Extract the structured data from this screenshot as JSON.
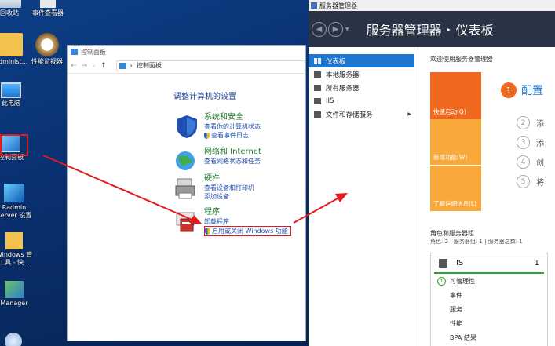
{
  "desktop": {
    "icons": [
      {
        "label": "回收站"
      },
      {
        "label": "事件查看器"
      },
      {
        "label": "Administ..."
      },
      {
        "label": "性能监视器"
      },
      {
        "label": "此电脑"
      },
      {
        "label": "控制面板"
      },
      {
        "label": "Radmin"
      },
      {
        "label": "Server 设置"
      },
      {
        "label": "Windows 管"
      },
      {
        "label": "工具 - 快..."
      },
      {
        "label": "Manager"
      }
    ]
  },
  "control_panel": {
    "window_title": "控制面板",
    "address": "控制面板",
    "heading": "调整计算机的设置",
    "categories": [
      {
        "title": "系统和安全",
        "links": [
          "查看你的计算机状态",
          "查看事件日志"
        ]
      },
      {
        "title": "网络和 Internet",
        "links": [
          "查看网络状态和任务"
        ]
      },
      {
        "title": "硬件",
        "links": [
          "查看设备和打印机",
          "添加设备"
        ]
      },
      {
        "title": "程序",
        "links": [
          "卸载程序",
          "启用或关闭 Windows 功能"
        ]
      }
    ]
  },
  "server_manager": {
    "window_title": "服务器管理器",
    "breadcrumb": {
      "app": "服务器管理器",
      "page": "仪表板"
    },
    "sidebar": [
      {
        "label": "仪表板",
        "active": true
      },
      {
        "label": "本地服务器"
      },
      {
        "label": "所有服务器"
      },
      {
        "label": "IIS"
      },
      {
        "label": "文件和存储服务"
      }
    ],
    "welcome": "欢迎使用服务器管理器",
    "tiles": [
      {
        "label": "快速启动(Q)",
        "color": "#f0681e"
      },
      {
        "label": "新增功能(W)",
        "color": "#f8a93a"
      },
      {
        "label": "了解详细信息(L)",
        "color": "#f8a93a"
      }
    ],
    "steps": [
      {
        "num": "1",
        "text": "配置"
      },
      {
        "num": "2",
        "text": "添"
      },
      {
        "num": "3",
        "text": "添"
      },
      {
        "num": "4",
        "text": "创"
      },
      {
        "num": "5",
        "text": "将"
      }
    ],
    "roles_title": "角色和服务器组",
    "roles_summary": "角色: 2 | 服务器组: 1 | 服务器总数: 1",
    "role_card": {
      "name": "IIS",
      "count": "1",
      "rows": [
        "可管理性",
        "事件",
        "服务",
        "性能",
        "BPA 结果"
      ]
    }
  }
}
